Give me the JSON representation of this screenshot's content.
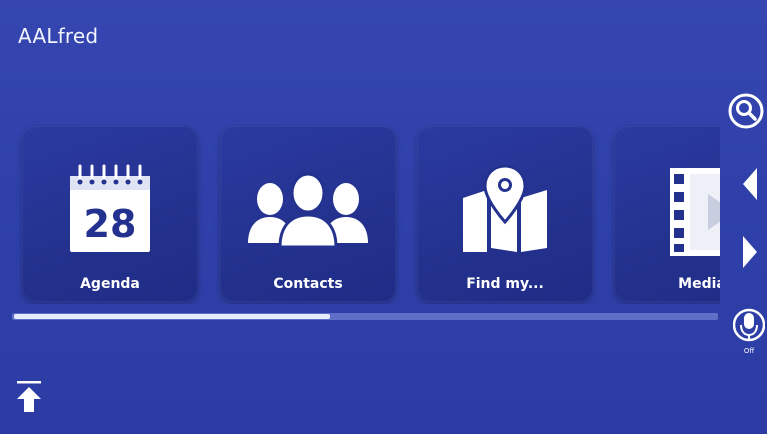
{
  "app": {
    "title": "AALfred"
  },
  "tiles": [
    {
      "label": "Agenda",
      "icon": "calendar-icon",
      "calendar_day": "28"
    },
    {
      "label": "Contacts",
      "icon": "people-icon"
    },
    {
      "label": "Find my...",
      "icon": "map-pin-icon"
    },
    {
      "label": "Media",
      "icon": "film-strip-icon"
    }
  ],
  "side_controls": {
    "search_icon": "search-icon",
    "previous_icon": "chevron-left-icon",
    "next_icon": "chevron-right-icon",
    "microphone_icon": "microphone-icon",
    "microphone_state": "Off"
  },
  "bottom_controls": {
    "scroll_top_icon": "arrow-up-to-top-icon"
  },
  "scrollbar": {
    "position_fraction": 0.45
  },
  "colors": {
    "background": "#2f3ea6",
    "tile": "#24328f",
    "scroll_track": "#5f6fc8",
    "scroll_thumb": "#e7ebff"
  }
}
